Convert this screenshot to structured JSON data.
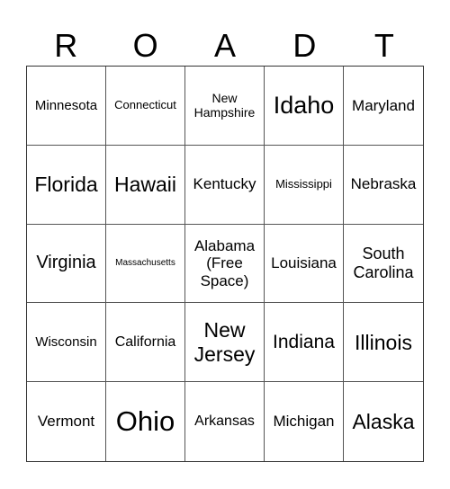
{
  "header": [
    "R",
    "O",
    "A",
    "D",
    "T"
  ],
  "cells": [
    {
      "text": "Minnesota",
      "size": 15
    },
    {
      "text": "Connecticut",
      "size": 13
    },
    {
      "text": "New Hampshire",
      "size": 14
    },
    {
      "text": "Idaho",
      "size": 27
    },
    {
      "text": "Maryland",
      "size": 17
    },
    {
      "text": "Florida",
      "size": 23
    },
    {
      "text": "Hawaii",
      "size": 23
    },
    {
      "text": "Kentucky",
      "size": 17
    },
    {
      "text": "Mississippi",
      "size": 13
    },
    {
      "text": "Nebraska",
      "size": 17
    },
    {
      "text": "Virginia",
      "size": 20
    },
    {
      "text": "Massachusetts",
      "size": 10
    },
    {
      "text": "Alabama (Free Space)",
      "size": 17
    },
    {
      "text": "Louisiana",
      "size": 17
    },
    {
      "text": "South Carolina",
      "size": 18
    },
    {
      "text": "Wisconsin",
      "size": 15
    },
    {
      "text": "California",
      "size": 16
    },
    {
      "text": "New Jersey",
      "size": 23
    },
    {
      "text": "Indiana",
      "size": 21
    },
    {
      "text": "Illinois",
      "size": 23
    },
    {
      "text": "Vermont",
      "size": 17
    },
    {
      "text": "Ohio",
      "size": 31
    },
    {
      "text": "Arkansas",
      "size": 16
    },
    {
      "text": "Michigan",
      "size": 17
    },
    {
      "text": "Alaska",
      "size": 23
    }
  ]
}
